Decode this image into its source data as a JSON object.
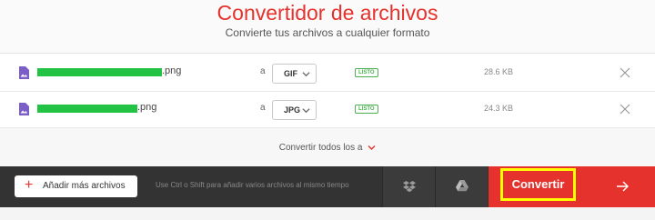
{
  "header": {
    "title": "Convertidor de archivos",
    "subtitle": "Convierte tus archivos a cualquier formato"
  },
  "files": [
    {
      "name_suffix": ".png",
      "to_label": "a",
      "format": "GIF",
      "status": "LISTO",
      "size": "28.6 KB"
    },
    {
      "name_suffix": ".png",
      "to_label": "a",
      "format": "JPG",
      "status": "LISTO",
      "size": "24.3 KB"
    }
  ],
  "convert_all": {
    "label": "Convertir todos los a"
  },
  "actions": {
    "add_files_label": "Añadir más archivos",
    "hint": "Use Ctrl o Shift para añadir varios archivos al mismo tiempo",
    "convert_label": "Convertir"
  },
  "colors": {
    "brand": "#e5322d",
    "highlight": "#ffff00",
    "redaction": "#22c244",
    "status": "#4caf50"
  },
  "icons": [
    "image-file-icon",
    "chevron-down-icon",
    "close-icon",
    "dropbox-icon",
    "google-drive-icon",
    "arrow-right-icon",
    "plus-icon"
  ]
}
